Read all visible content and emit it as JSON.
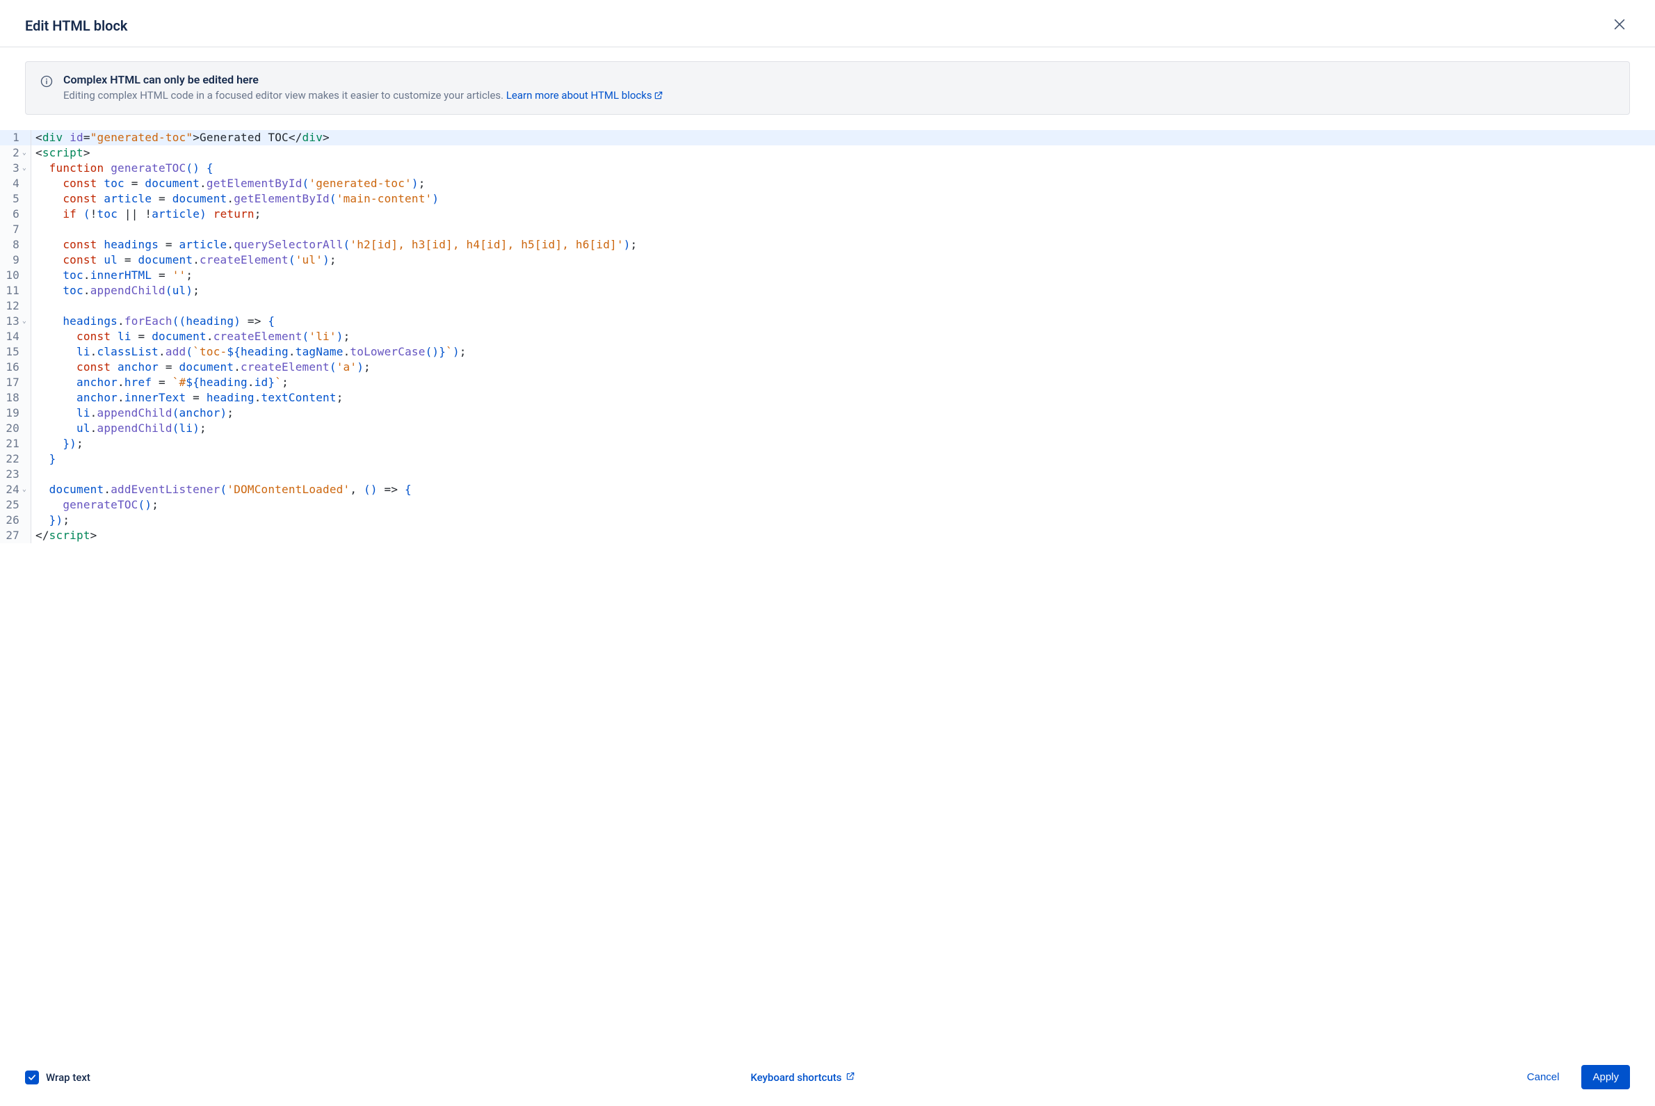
{
  "header": {
    "title": "Edit HTML block",
    "close_label": "Close"
  },
  "info": {
    "title": "Complex HTML can only be edited here",
    "desc_prefix": "Editing complex HTML code in a focused editor view makes it easier to customize your articles. ",
    "link_text": "Learn more about HTML blocks"
  },
  "editor": {
    "lines": [
      {
        "n": 1,
        "fold": "",
        "hl": true,
        "tokens": [
          {
            "t": "<",
            "c": "punct"
          },
          {
            "t": "div",
            "c": "tag"
          },
          {
            "t": " ",
            "c": "plain"
          },
          {
            "t": "id",
            "c": "attr"
          },
          {
            "t": "=",
            "c": "punct"
          },
          {
            "t": "\"generated-toc\"",
            "c": "string"
          },
          {
            "t": ">",
            "c": "punct"
          },
          {
            "t": "Generated TOC",
            "c": "plain"
          },
          {
            "t": "</",
            "c": "punct"
          },
          {
            "t": "div",
            "c": "tag"
          },
          {
            "t": ">",
            "c": "punct"
          }
        ]
      },
      {
        "n": 2,
        "fold": "v",
        "tokens": [
          {
            "t": "<",
            "c": "punct"
          },
          {
            "t": "script",
            "c": "tag"
          },
          {
            "t": ">",
            "c": "punct"
          }
        ]
      },
      {
        "n": 3,
        "fold": "v",
        "tokens": [
          {
            "t": "  ",
            "c": "plain"
          },
          {
            "t": "function",
            "c": "keyword"
          },
          {
            "t": " ",
            "c": "plain"
          },
          {
            "t": "generateTOC",
            "c": "func"
          },
          {
            "t": "()",
            "c": "paren"
          },
          {
            "t": " ",
            "c": "plain"
          },
          {
            "t": "{",
            "c": "paren"
          }
        ]
      },
      {
        "n": 4,
        "fold": "",
        "tokens": [
          {
            "t": "    ",
            "c": "plain"
          },
          {
            "t": "const",
            "c": "keyword"
          },
          {
            "t": " ",
            "c": "plain"
          },
          {
            "t": "toc",
            "c": "ident"
          },
          {
            "t": " = ",
            "c": "plain"
          },
          {
            "t": "document",
            "c": "ident"
          },
          {
            "t": ".",
            "c": "plain"
          },
          {
            "t": "getElementById",
            "c": "func"
          },
          {
            "t": "(",
            "c": "paren"
          },
          {
            "t": "'generated-toc'",
            "c": "string"
          },
          {
            "t": ")",
            "c": "paren"
          },
          {
            "t": ";",
            "c": "punct"
          }
        ]
      },
      {
        "n": 5,
        "fold": "",
        "tokens": [
          {
            "t": "    ",
            "c": "plain"
          },
          {
            "t": "const",
            "c": "keyword"
          },
          {
            "t": " ",
            "c": "plain"
          },
          {
            "t": "article",
            "c": "ident"
          },
          {
            "t": " = ",
            "c": "plain"
          },
          {
            "t": "document",
            "c": "ident"
          },
          {
            "t": ".",
            "c": "plain"
          },
          {
            "t": "getElementById",
            "c": "func"
          },
          {
            "t": "(",
            "c": "paren"
          },
          {
            "t": "'main-content'",
            "c": "string"
          },
          {
            "t": ")",
            "c": "paren"
          }
        ]
      },
      {
        "n": 6,
        "fold": "",
        "tokens": [
          {
            "t": "    ",
            "c": "plain"
          },
          {
            "t": "if",
            "c": "keyword"
          },
          {
            "t": " ",
            "c": "plain"
          },
          {
            "t": "(",
            "c": "paren"
          },
          {
            "t": "!",
            "c": "plain"
          },
          {
            "t": "toc",
            "c": "ident"
          },
          {
            "t": " || !",
            "c": "plain"
          },
          {
            "t": "article",
            "c": "ident"
          },
          {
            "t": ")",
            "c": "paren"
          },
          {
            "t": " ",
            "c": "plain"
          },
          {
            "t": "return",
            "c": "keyword"
          },
          {
            "t": ";",
            "c": "punct"
          }
        ]
      },
      {
        "n": 7,
        "fold": "",
        "tokens": []
      },
      {
        "n": 8,
        "fold": "",
        "tokens": [
          {
            "t": "    ",
            "c": "plain"
          },
          {
            "t": "const",
            "c": "keyword"
          },
          {
            "t": " ",
            "c": "plain"
          },
          {
            "t": "headings",
            "c": "ident"
          },
          {
            "t": " = ",
            "c": "plain"
          },
          {
            "t": "article",
            "c": "ident"
          },
          {
            "t": ".",
            "c": "plain"
          },
          {
            "t": "querySelectorAll",
            "c": "func"
          },
          {
            "t": "(",
            "c": "paren"
          },
          {
            "t": "'h2[id], h3[id], h4[id], h5[id], h6[id]'",
            "c": "string"
          },
          {
            "t": ")",
            "c": "paren"
          },
          {
            "t": ";",
            "c": "punct"
          }
        ]
      },
      {
        "n": 9,
        "fold": "",
        "tokens": [
          {
            "t": "    ",
            "c": "plain"
          },
          {
            "t": "const",
            "c": "keyword"
          },
          {
            "t": " ",
            "c": "plain"
          },
          {
            "t": "ul",
            "c": "ident"
          },
          {
            "t": " = ",
            "c": "plain"
          },
          {
            "t": "document",
            "c": "ident"
          },
          {
            "t": ".",
            "c": "plain"
          },
          {
            "t": "createElement",
            "c": "func"
          },
          {
            "t": "(",
            "c": "paren"
          },
          {
            "t": "'ul'",
            "c": "string"
          },
          {
            "t": ")",
            "c": "paren"
          },
          {
            "t": ";",
            "c": "punct"
          }
        ]
      },
      {
        "n": 10,
        "fold": "",
        "tokens": [
          {
            "t": "    ",
            "c": "plain"
          },
          {
            "t": "toc",
            "c": "ident"
          },
          {
            "t": ".",
            "c": "plain"
          },
          {
            "t": "innerHTML",
            "c": "ident"
          },
          {
            "t": " = ",
            "c": "plain"
          },
          {
            "t": "''",
            "c": "string"
          },
          {
            "t": ";",
            "c": "punct"
          }
        ]
      },
      {
        "n": 11,
        "fold": "",
        "tokens": [
          {
            "t": "    ",
            "c": "plain"
          },
          {
            "t": "toc",
            "c": "ident"
          },
          {
            "t": ".",
            "c": "plain"
          },
          {
            "t": "appendChild",
            "c": "func"
          },
          {
            "t": "(",
            "c": "paren"
          },
          {
            "t": "ul",
            "c": "ident"
          },
          {
            "t": ")",
            "c": "paren"
          },
          {
            "t": ";",
            "c": "punct"
          }
        ]
      },
      {
        "n": 12,
        "fold": "",
        "tokens": []
      },
      {
        "n": 13,
        "fold": "v",
        "tokens": [
          {
            "t": "    ",
            "c": "plain"
          },
          {
            "t": "headings",
            "c": "ident"
          },
          {
            "t": ".",
            "c": "plain"
          },
          {
            "t": "forEach",
            "c": "func"
          },
          {
            "t": "((",
            "c": "paren"
          },
          {
            "t": "heading",
            "c": "ident"
          },
          {
            "t": ")",
            "c": "paren"
          },
          {
            "t": " => ",
            "c": "plain"
          },
          {
            "t": "{",
            "c": "paren"
          }
        ]
      },
      {
        "n": 14,
        "fold": "",
        "tokens": [
          {
            "t": "      ",
            "c": "plain"
          },
          {
            "t": "const",
            "c": "keyword"
          },
          {
            "t": " ",
            "c": "plain"
          },
          {
            "t": "li",
            "c": "ident"
          },
          {
            "t": " = ",
            "c": "plain"
          },
          {
            "t": "document",
            "c": "ident"
          },
          {
            "t": ".",
            "c": "plain"
          },
          {
            "t": "createElement",
            "c": "func"
          },
          {
            "t": "(",
            "c": "paren"
          },
          {
            "t": "'li'",
            "c": "string"
          },
          {
            "t": ")",
            "c": "paren"
          },
          {
            "t": ";",
            "c": "punct"
          }
        ]
      },
      {
        "n": 15,
        "fold": "",
        "tokens": [
          {
            "t": "      ",
            "c": "plain"
          },
          {
            "t": "li",
            "c": "ident"
          },
          {
            "t": ".",
            "c": "plain"
          },
          {
            "t": "classList",
            "c": "ident"
          },
          {
            "t": ".",
            "c": "plain"
          },
          {
            "t": "add",
            "c": "func"
          },
          {
            "t": "(",
            "c": "paren"
          },
          {
            "t": "`toc-",
            "c": "string"
          },
          {
            "t": "${",
            "c": "paren"
          },
          {
            "t": "heading",
            "c": "ident"
          },
          {
            "t": ".",
            "c": "plain"
          },
          {
            "t": "tagName",
            "c": "ident"
          },
          {
            "t": ".",
            "c": "plain"
          },
          {
            "t": "toLowerCase",
            "c": "func"
          },
          {
            "t": "()",
            "c": "paren"
          },
          {
            "t": "}",
            "c": "paren"
          },
          {
            "t": "`",
            "c": "string"
          },
          {
            "t": ")",
            "c": "paren"
          },
          {
            "t": ";",
            "c": "punct"
          }
        ]
      },
      {
        "n": 16,
        "fold": "",
        "tokens": [
          {
            "t": "      ",
            "c": "plain"
          },
          {
            "t": "const",
            "c": "keyword"
          },
          {
            "t": " ",
            "c": "plain"
          },
          {
            "t": "anchor",
            "c": "ident"
          },
          {
            "t": " = ",
            "c": "plain"
          },
          {
            "t": "document",
            "c": "ident"
          },
          {
            "t": ".",
            "c": "plain"
          },
          {
            "t": "createElement",
            "c": "func"
          },
          {
            "t": "(",
            "c": "paren"
          },
          {
            "t": "'a'",
            "c": "string"
          },
          {
            "t": ")",
            "c": "paren"
          },
          {
            "t": ";",
            "c": "punct"
          }
        ]
      },
      {
        "n": 17,
        "fold": "",
        "tokens": [
          {
            "t": "      ",
            "c": "plain"
          },
          {
            "t": "anchor",
            "c": "ident"
          },
          {
            "t": ".",
            "c": "plain"
          },
          {
            "t": "href",
            "c": "ident"
          },
          {
            "t": " = ",
            "c": "plain"
          },
          {
            "t": "`#",
            "c": "string"
          },
          {
            "t": "${",
            "c": "paren"
          },
          {
            "t": "heading",
            "c": "ident"
          },
          {
            "t": ".",
            "c": "plain"
          },
          {
            "t": "id",
            "c": "ident"
          },
          {
            "t": "}",
            "c": "paren"
          },
          {
            "t": "`",
            "c": "string"
          },
          {
            "t": ";",
            "c": "punct"
          }
        ]
      },
      {
        "n": 18,
        "fold": "",
        "tokens": [
          {
            "t": "      ",
            "c": "plain"
          },
          {
            "t": "anchor",
            "c": "ident"
          },
          {
            "t": ".",
            "c": "plain"
          },
          {
            "t": "innerText",
            "c": "ident"
          },
          {
            "t": " = ",
            "c": "plain"
          },
          {
            "t": "heading",
            "c": "ident"
          },
          {
            "t": ".",
            "c": "plain"
          },
          {
            "t": "textContent",
            "c": "ident"
          },
          {
            "t": ";",
            "c": "punct"
          }
        ]
      },
      {
        "n": 19,
        "fold": "",
        "tokens": [
          {
            "t": "      ",
            "c": "plain"
          },
          {
            "t": "li",
            "c": "ident"
          },
          {
            "t": ".",
            "c": "plain"
          },
          {
            "t": "appendChild",
            "c": "func"
          },
          {
            "t": "(",
            "c": "paren"
          },
          {
            "t": "anchor",
            "c": "ident"
          },
          {
            "t": ")",
            "c": "paren"
          },
          {
            "t": ";",
            "c": "punct"
          }
        ]
      },
      {
        "n": 20,
        "fold": "",
        "tokens": [
          {
            "t": "      ",
            "c": "plain"
          },
          {
            "t": "ul",
            "c": "ident"
          },
          {
            "t": ".",
            "c": "plain"
          },
          {
            "t": "appendChild",
            "c": "func"
          },
          {
            "t": "(",
            "c": "paren"
          },
          {
            "t": "li",
            "c": "ident"
          },
          {
            "t": ")",
            "c": "paren"
          },
          {
            "t": ";",
            "c": "punct"
          }
        ]
      },
      {
        "n": 21,
        "fold": "",
        "tokens": [
          {
            "t": "    ",
            "c": "plain"
          },
          {
            "t": "})",
            "c": "paren"
          },
          {
            "t": ";",
            "c": "punct"
          }
        ]
      },
      {
        "n": 22,
        "fold": "",
        "tokens": [
          {
            "t": "  ",
            "c": "plain"
          },
          {
            "t": "}",
            "c": "paren"
          }
        ]
      },
      {
        "n": 23,
        "fold": "",
        "tokens": []
      },
      {
        "n": 24,
        "fold": "v",
        "tokens": [
          {
            "t": "  ",
            "c": "plain"
          },
          {
            "t": "document",
            "c": "ident"
          },
          {
            "t": ".",
            "c": "plain"
          },
          {
            "t": "addEventListener",
            "c": "func"
          },
          {
            "t": "(",
            "c": "paren"
          },
          {
            "t": "'DOMContentLoaded'",
            "c": "string"
          },
          {
            "t": ", ",
            "c": "plain"
          },
          {
            "t": "()",
            "c": "paren"
          },
          {
            "t": " => ",
            "c": "plain"
          },
          {
            "t": "{",
            "c": "paren"
          }
        ]
      },
      {
        "n": 25,
        "fold": "",
        "tokens": [
          {
            "t": "    ",
            "c": "plain"
          },
          {
            "t": "generateTOC",
            "c": "func"
          },
          {
            "t": "()",
            "c": "paren"
          },
          {
            "t": ";",
            "c": "punct"
          }
        ]
      },
      {
        "n": 26,
        "fold": "",
        "tokens": [
          {
            "t": "  ",
            "c": "plain"
          },
          {
            "t": "})",
            "c": "paren"
          },
          {
            "t": ";",
            "c": "punct"
          }
        ]
      },
      {
        "n": 27,
        "fold": "",
        "tokens": [
          {
            "t": "</",
            "c": "punct"
          },
          {
            "t": "script",
            "c": "tag"
          },
          {
            "t": ">",
            "c": "punct"
          }
        ]
      }
    ]
  },
  "footer": {
    "wrap_text_label": "Wrap text",
    "keyboard_label": "Keyboard shortcuts",
    "cancel_label": "Cancel",
    "apply_label": "Apply"
  }
}
